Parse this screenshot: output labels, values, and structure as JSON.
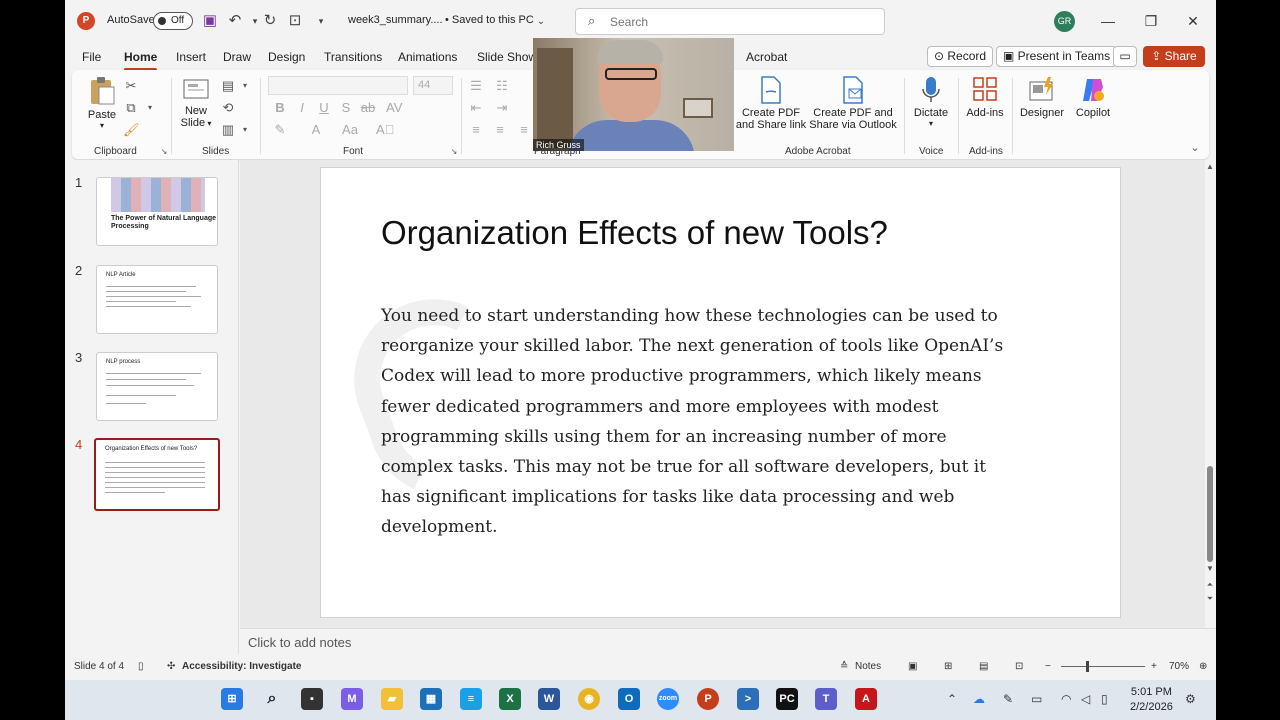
{
  "titlebar": {
    "autosave_label": "AutoSave",
    "autosave_state": "Off",
    "filename": "week3_summary....",
    "saved_status": "• Saved to this PC",
    "search_placeholder": "Search",
    "avatar_initials": "GR"
  },
  "tabs": [
    "File",
    "Home",
    "Insert",
    "Draw",
    "Design",
    "Transitions",
    "Animations",
    "Slide Show",
    "Acrobat"
  ],
  "active_tab": "Home",
  "header_buttons": {
    "record": "Record",
    "present": "Present in Teams",
    "share": "Share"
  },
  "ribbon": {
    "paste": "Paste",
    "clipboard": "Clipboard",
    "new_slide_1": "New",
    "new_slide_2": "Slide",
    "slides": "Slides",
    "font_size": "44",
    "font": "Font",
    "paragraph": "Paragraph",
    "create_pdf_share_1": "Create PDF",
    "create_pdf_share_2": "and Share link",
    "create_pdf_outlook_1": "Create PDF and",
    "create_pdf_outlook_2": "Share via Outlook",
    "adobe_acrobat": "Adobe Acrobat",
    "dictate": "Dictate",
    "voice": "Voice",
    "addins_btn": "Add-ins",
    "addins_group": "Add-ins",
    "designer": "Designer",
    "copilot": "Copilot"
  },
  "video": {
    "participant": "Rich Gruss"
  },
  "thumbnails": [
    {
      "num": "1",
      "title": "The Power of Natural Language Processing"
    },
    {
      "num": "2",
      "title": "NLP Article"
    },
    {
      "num": "3",
      "title": "NLP process"
    },
    {
      "num": "4",
      "title": "Organization Effects of new Tools?"
    }
  ],
  "slide": {
    "title": "Organization Effects of new Tools?",
    "body": "You need to start understanding how these technologies can be used to reorganize your skilled labor. The next generation of tools like OpenAI’s Codex will lead to more productive programmers, which likely means fewer dedicated programmers and more employees with modest programming skills using them for an increasing number of more complex tasks. This may not be true for all software developers, but it has significant implications for tasks like data processing and web development."
  },
  "notes_placeholder": "Click to add notes",
  "status": {
    "slide_of": "Slide 4 of 4",
    "accessibility": "Accessibility: Investigate",
    "notes": "Notes",
    "zoom": "70%"
  },
  "clock": {
    "time": "5:01 PM",
    "date": "2/2/2026"
  },
  "colors": {
    "accent": "#c43e1c",
    "active_thumb_border": "#9b1b1b"
  }
}
